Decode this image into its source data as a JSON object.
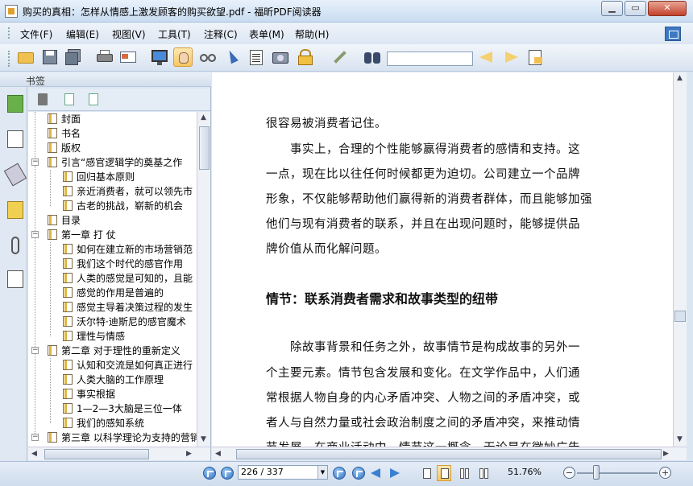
{
  "window": {
    "title": "购买的真相：怎样从情感上激发顾客的购买欲望.pdf - 福昕PDF阅读器",
    "min_label": "▁",
    "max_label": "▭",
    "close_label": "✕"
  },
  "menu": {
    "items": [
      {
        "label": "文件(F)"
      },
      {
        "label": "编辑(E)"
      },
      {
        "label": "视图(V)"
      },
      {
        "label": "工具(T)"
      },
      {
        "label": "注释(C)"
      },
      {
        "label": "表单(M)"
      },
      {
        "label": "帮助(H)"
      }
    ]
  },
  "toolbar": {
    "icons": [
      "open-folder-icon",
      "save-icon",
      "save-all-icon",
      "print-icon",
      "email-icon",
      "fullscreen-icon",
      "hand-tool-icon",
      "zoom-glass-icon",
      "select-arrow-icon",
      "text-select-icon",
      "snapshot-icon",
      "lock-rms-icon",
      "sign-pen-icon",
      "binoculars-icon",
      "search-back-icon",
      "search-forward-icon",
      "highlight-icon"
    ],
    "search_value": "",
    "active_tool": "hand-tool-icon"
  },
  "bookmarks": {
    "header_label": "书签",
    "items": [
      {
        "label": "封面",
        "level": 0,
        "expanded": null
      },
      {
        "label": "书名",
        "level": 0,
        "expanded": null
      },
      {
        "label": "版权",
        "level": 0,
        "expanded": null
      },
      {
        "label": "引言“感官逻辑学的奠基之作",
        "level": 0,
        "expanded": true
      },
      {
        "label": "回归基本原则",
        "level": 1,
        "expanded": null
      },
      {
        "label": "亲近消费者，就可以领先市",
        "level": 1,
        "expanded": null
      },
      {
        "label": "古老的挑战，崭新的机会",
        "level": 1,
        "expanded": null
      },
      {
        "label": "目录",
        "level": 0,
        "expanded": null
      },
      {
        "label": "第一章 打 仗",
        "level": 0,
        "expanded": true
      },
      {
        "label": "如何在建立新的市场营销范",
        "level": 1,
        "expanded": null
      },
      {
        "label": "我们这个时代的感官作用",
        "level": 1,
        "expanded": null
      },
      {
        "label": "人类的感觉是可知的，且能",
        "level": 1,
        "expanded": null
      },
      {
        "label": "感觉的作用是普遍的",
        "level": 1,
        "expanded": null
      },
      {
        "label": "感觉主导着决策过程的发生",
        "level": 1,
        "expanded": null
      },
      {
        "label": "沃尔特·迪斯尼的感官魔术",
        "level": 1,
        "expanded": null
      },
      {
        "label": "理性与情感",
        "level": 1,
        "expanded": null
      },
      {
        "label": "第二章 对于理性的重新定义",
        "level": 0,
        "expanded": true
      },
      {
        "label": "认知和交流是如何真正进行",
        "level": 1,
        "expanded": null
      },
      {
        "label": "人类大脑的工作原理",
        "level": 1,
        "expanded": null
      },
      {
        "label": "事实根据",
        "level": 1,
        "expanded": null
      },
      {
        "label": "1—2—3大脑是三位一体",
        "level": 1,
        "expanded": null
      },
      {
        "label": "我们的感知系统",
        "level": 1,
        "expanded": null
      },
      {
        "label": "第三章 以科学理论为支持的营销",
        "level": 0,
        "expanded": true
      }
    ]
  },
  "document": {
    "lines": [
      "很容易被消费者记住。",
      "　　事实上，合理的个性能够赢得消费者的感情和支持。这",
      "一点，现在比以往任何时候都更为迫切。公司建立一个品牌",
      "形象，不仅能够帮助他们赢得新的消费者群体，而且能够加强",
      "他们与现有消费者的联系，并且在出现问题时，能够提供品",
      "牌价值从而化解问题。"
    ],
    "heading": "情节：联系消费者需求和故事类型的纽带",
    "lines2": [
      "　　除故事背景和任务之外，故事情节是构成故事的另外一",
      "个主要元素。情节包含发展和变化。在文学作品中，人们通",
      "常根据人物自身的内心矛盾冲突、人物之间的矛盾冲突，或",
      "者人与自然力量或社会政治制度之间的矛盾冲突，来推动情",
      "节发展。在商业活动中，情节这一概念，无论是在微妙广告"
    ]
  },
  "status": {
    "page_current": "226",
    "page_total": "337",
    "page_display": "226 / 337",
    "zoom_level": "51.76%",
    "active_layout": "single-page-continuous"
  }
}
